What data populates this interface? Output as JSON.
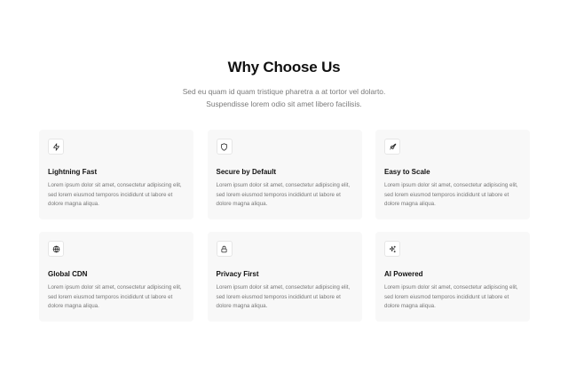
{
  "header": {
    "title": "Why Choose Us",
    "subtitle_line1": "Sed eu quam id quam tristique pharetra a at tortor vel dolarto.",
    "subtitle_line2": "Suspendisse lorem odio sit amet libero facilisis."
  },
  "features": [
    {
      "icon": "lightning-icon",
      "title": "Lightning Fast",
      "description": "Lorem ipsum dolor sit amet, consectetur adipiscing elit, sed lorem eiusmod temporos incididunt ut labore et dolore magna aliqua."
    },
    {
      "icon": "shield-icon",
      "title": "Secure by Default",
      "description": "Lorem ipsum dolor sit amet, consectetur adipiscing elit, sed lorem eiusmod temporos incididunt ut labore et dolore magna aliqua."
    },
    {
      "icon": "rocket-icon",
      "title": "Easy to Scale",
      "description": "Lorem ipsum dolor sit amet, consectetur adipiscing elit, sed lorem eiusmod temporos incididunt ut labore et dolore magna aliqua."
    },
    {
      "icon": "globe-icon",
      "title": "Global CDN",
      "description": "Lorem ipsum dolor sit amet, consectetur adipiscing elit, sed lorem eiusmod temporos incididunt ut labore et dolore magna aliqua."
    },
    {
      "icon": "lock-icon",
      "title": "Privacy First",
      "description": "Lorem ipsum dolor sit amet, consectetur adipiscing elit, sed lorem eiusmod temporos incididunt ut labore et dolore magna aliqua."
    },
    {
      "icon": "sparkles-icon",
      "title": "AI Powered",
      "description": "Lorem ipsum dolor sit amet, consectetur adipiscing elit, sed lorem eiusmod temporos incididunt ut labore et dolore magna aliqua."
    }
  ]
}
